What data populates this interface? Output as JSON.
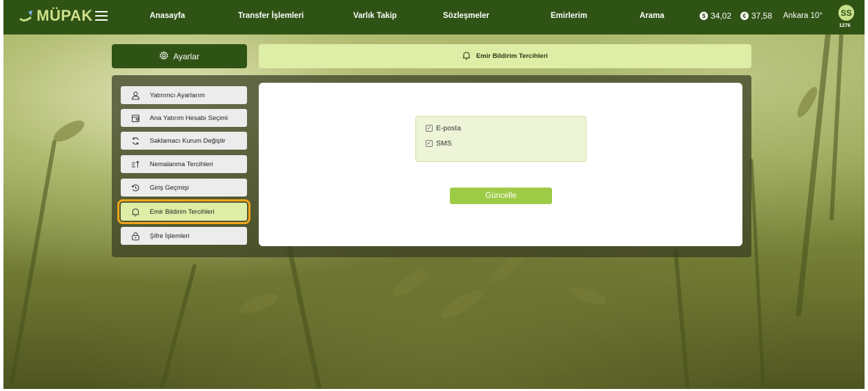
{
  "app": {
    "logo_text": "MÜPAK"
  },
  "nav": {
    "items": [
      "Anasayfa",
      "Transfer İşlemleri",
      "Varlık Takip",
      "Sözleşmeler",
      "Emirlerim",
      "Arama"
    ]
  },
  "rates": {
    "usd": {
      "symbol": "$",
      "value": "34,02"
    },
    "eur": {
      "symbol": "€",
      "value": "37,58"
    }
  },
  "weather": "Ankara 10°",
  "user": {
    "initials": "SS",
    "code": "1276"
  },
  "settings_header": "Ayarlar",
  "page_header": "Emir Bildirim Tercihleri",
  "sidebar": {
    "items": [
      {
        "label": "Yatırımcı Ayarlarım",
        "icon": "user-icon"
      },
      {
        "label": "Ana Yatırım Hesabı Seçimi",
        "icon": "wallet-icon"
      },
      {
        "label": "Saklamacı Kurum Değiştir",
        "icon": "refresh-icon"
      },
      {
        "label": "Nemalanma Tercihleri",
        "icon": "sort-icon"
      },
      {
        "label": "Giriş Geçmişi",
        "icon": "history-icon"
      },
      {
        "label": "Emir Bildirim Tercihleri",
        "icon": "bell-icon"
      },
      {
        "label": "Şifre İşlemleri",
        "icon": "lock-icon"
      }
    ],
    "active_index": 5
  },
  "preferences": {
    "email_label": "E-posta",
    "email_checked": true,
    "sms_label": "SMS",
    "sms_checked": true
  },
  "update_button": "Güncelle",
  "colors": {
    "topbar": "#2f5314",
    "accent_light": "#dfeea6",
    "button": "#9dcb45",
    "highlight": "#f2a51a"
  }
}
